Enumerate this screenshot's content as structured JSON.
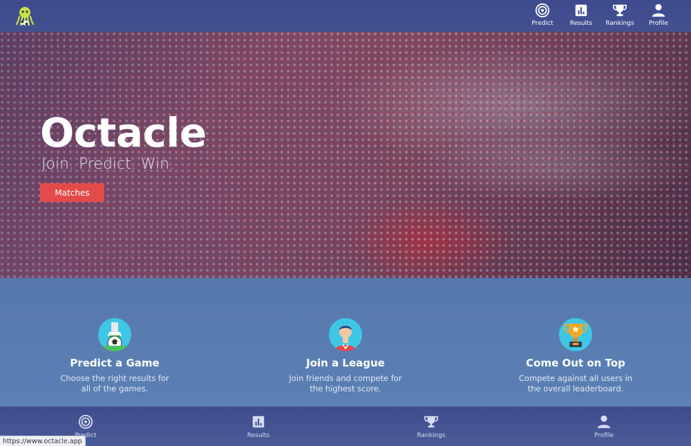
{
  "nav": {
    "items": [
      {
        "label": "Predict",
        "icon": "target-icon"
      },
      {
        "label": "Results",
        "icon": "bar-chart-icon"
      },
      {
        "label": "Rankings",
        "icon": "trophy-icon"
      },
      {
        "label": "Profile",
        "icon": "user-icon"
      }
    ]
  },
  "hero": {
    "title": "Octacle",
    "tagline": "Join. Predict. Win.",
    "button_label": "Matches"
  },
  "features": [
    {
      "title": "Predict a Game",
      "description": "Choose the right results for all of the games.",
      "icon": "soccer-ball-icon"
    },
    {
      "title": "Join a League",
      "description": "Join friends and compete for the highest score.",
      "icon": "player-avatar-icon"
    },
    {
      "title": "Come Out on Top",
      "description": "Compete against all users in the overall leaderboard.",
      "icon": "gold-trophy-icon"
    }
  ],
  "status_url": "https://www.octacle.app",
  "colors": {
    "nav_bg": "#3e4a8e",
    "accent_button": "#e34a4a",
    "features_bg": "#5678ad"
  }
}
